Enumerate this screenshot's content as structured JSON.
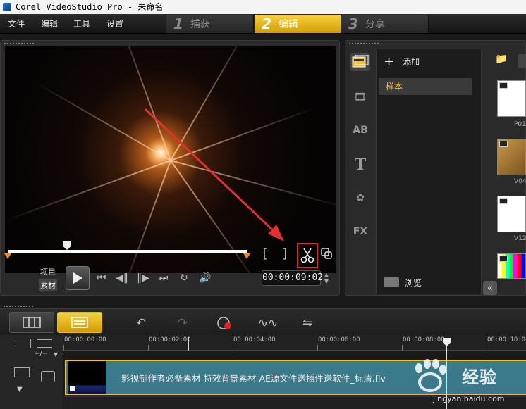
{
  "window": {
    "title": "Corel VideoStudio Pro - 未命名"
  },
  "menu": {
    "file": "文件",
    "edit": "编辑",
    "tools": "工具",
    "settings": "设置"
  },
  "steps": [
    {
      "num": "1",
      "label": "捕获",
      "active": false
    },
    {
      "num": "2",
      "label": "编辑",
      "active": true
    },
    {
      "num": "3",
      "label": "分享",
      "active": false
    }
  ],
  "player": {
    "mode_project": "项目",
    "mode_clip": "素材",
    "timecode": "00:00:09:02",
    "mark_in": "[",
    "mark_out": "]"
  },
  "library": {
    "add_label": "添加",
    "folder": "样本",
    "browse_label": "浏览",
    "thumbs": [
      {
        "label": "P01"
      },
      {
        "label": "V04"
      },
      {
        "label": "V12"
      }
    ]
  },
  "timeline": {
    "zoom_label": "+/−",
    "ticks": [
      "00:00:00:00",
      "00:00:02:00",
      "00:00:04:00",
      "00:00:06:00",
      "00:00:08:00",
      "00:00:10:00"
    ],
    "clip_title": "影视制作者必备素材 特效背景素材 AE源文件送插件送软件_标清.flv"
  },
  "watermark": {
    "brand": "经验",
    "url": "jingyan.baidu.com"
  },
  "colors": {
    "accent": "#f2c230",
    "highlight": "#e02626"
  }
}
